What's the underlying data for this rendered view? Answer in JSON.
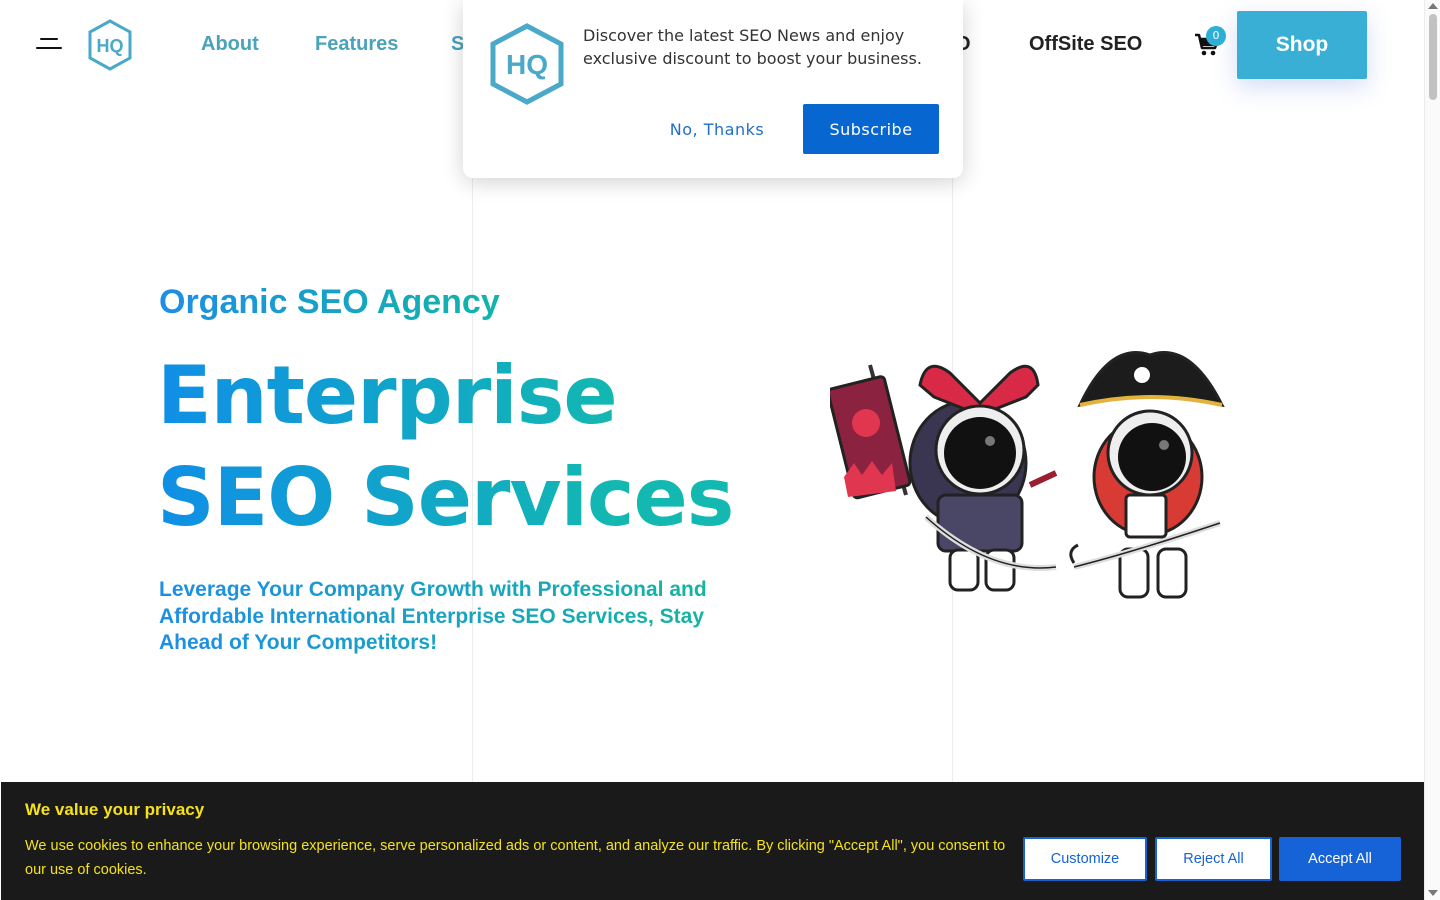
{
  "header": {
    "logo_text": "HQ",
    "nav": [
      {
        "label": "About"
      },
      {
        "label": "Features"
      },
      {
        "label": "S"
      },
      {
        "label": "O"
      },
      {
        "label": "OffSite SEO"
      }
    ],
    "cart_count": "0",
    "shop_label": "Shop"
  },
  "hero": {
    "eyebrow": "Organic SEO Agency",
    "title_line1": "Enterprise",
    "title_line2": "SEO Services",
    "subtitle": "Leverage Your Company Growth with Professional and Affordable International Enterprise SEO Services, Stay Ahead of Your Competitors!"
  },
  "popup": {
    "message": "Discover the latest SEO News and enjoy exclusive discount to boost your business.",
    "decline_label": "No, Thanks",
    "subscribe_label": "Subscribe"
  },
  "cookie": {
    "title": "We value your privacy",
    "text": "We use cookies to enhance your browsing experience, serve personalized ads or content, and analyze our traffic. By clicking \"Accept All\", you consent to our use of cookies.",
    "customize_label": "Customize",
    "reject_label": "Reject All",
    "accept_label": "Accept All"
  },
  "colors": {
    "brand_teal": "#4aa3b8",
    "shop_button": "#3aafd6",
    "primary_blue": "#0866d0",
    "cookie_bg": "#1a1a1a",
    "cookie_text": "#f5e21b"
  },
  "icons": [
    "hamburger-menu-icon",
    "hq-logo",
    "cart-icon"
  ]
}
